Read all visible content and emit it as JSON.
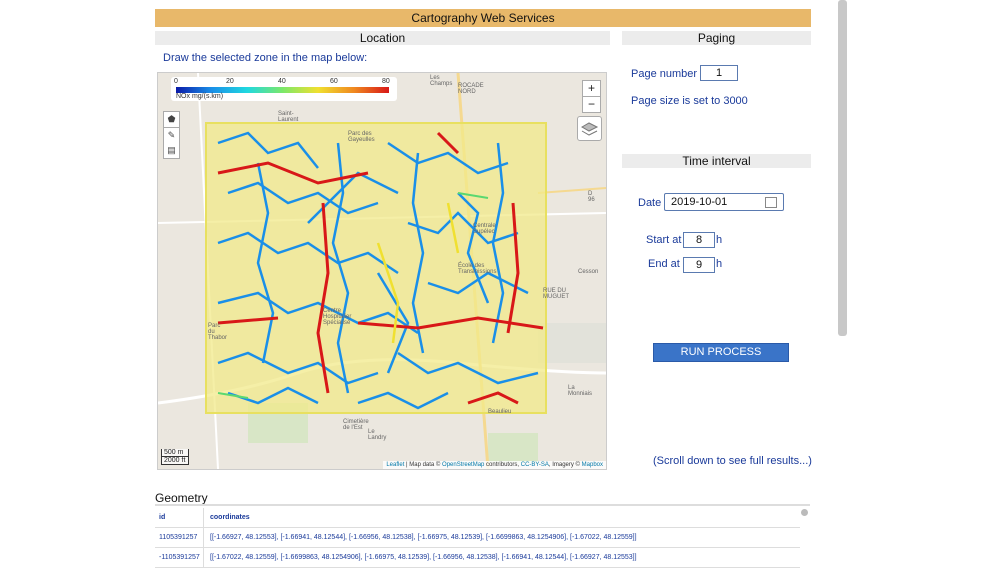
{
  "header": {
    "title": "Cartography Web Services"
  },
  "sections": {
    "location": "Location",
    "paging": "Paging",
    "time_interval": "Time interval",
    "geometry": "Geometry"
  },
  "map": {
    "prompt": "Draw the selected zone in the map below:",
    "legend": {
      "ticks": [
        "0",
        "20",
        "40",
        "60",
        "80"
      ],
      "unit": "NOx mg/(s.km)"
    },
    "zoom_in": "+",
    "zoom_out": "−",
    "scale": {
      "metric": "500 m",
      "imperial": "2000 ft"
    },
    "attribution": {
      "leaflet": "Leaflet",
      "middle": " | Map data © ",
      "osm": "OpenStreetMap",
      "contrib": " contributors, ",
      "license": "CC-BY-SA",
      "imagery": ", Imagery © ",
      "mapbox": "Mapbox"
    },
    "place_labels": [
      "Les Champs",
      "ROCADE NORD",
      "Saint-Laurent",
      "Parc des Gayeulles",
      "D 96",
      "Centrale Supélec",
      "École des Transmissions",
      "Cesson",
      "RUE DU MUGUET",
      "Centre Hospitalier Spécialisé",
      "Parc du Thabor",
      "La Monniais",
      "Le Landry",
      "Cimetière de l'Est",
      "Beaulieu"
    ],
    "colors": {
      "zone_fill": "#f2e98a",
      "low": "#1a8fe8",
      "high": "#d81818"
    }
  },
  "paging": {
    "page_number_label": "Page number",
    "page_number_value": "1",
    "page_size_text": "Page size is set to 3000"
  },
  "time": {
    "date_label": "Date",
    "date_value": "2019-10-01",
    "start_label": "Start at",
    "start_value": "8",
    "end_label": "End at",
    "end_value": "9",
    "unit": "h"
  },
  "actions": {
    "run_label": "RUN PROCESS",
    "scroll_hint": "(Scroll down to see full results...)"
  },
  "geometry_table": {
    "columns": [
      "id",
      "coordinates"
    ],
    "rows": [
      {
        "id": "1105391257",
        "coordinates": "[[-1.66927, 48.12553], [-1.66941, 48.12544], [-1.66956, 48.12538], [-1.66975, 48.12539], [-1.6699863, 48.1254906], [-1.67022, 48.12559]]"
      },
      {
        "id": "-1105391257",
        "coordinates": "[[-1.67022, 48.12559], [-1.6699863, 48.1254906], [-1.66975, 48.12539], [-1.66956, 48.12538], [-1.66941, 48.12544], [-1.66927, 48.12553]]"
      }
    ]
  }
}
